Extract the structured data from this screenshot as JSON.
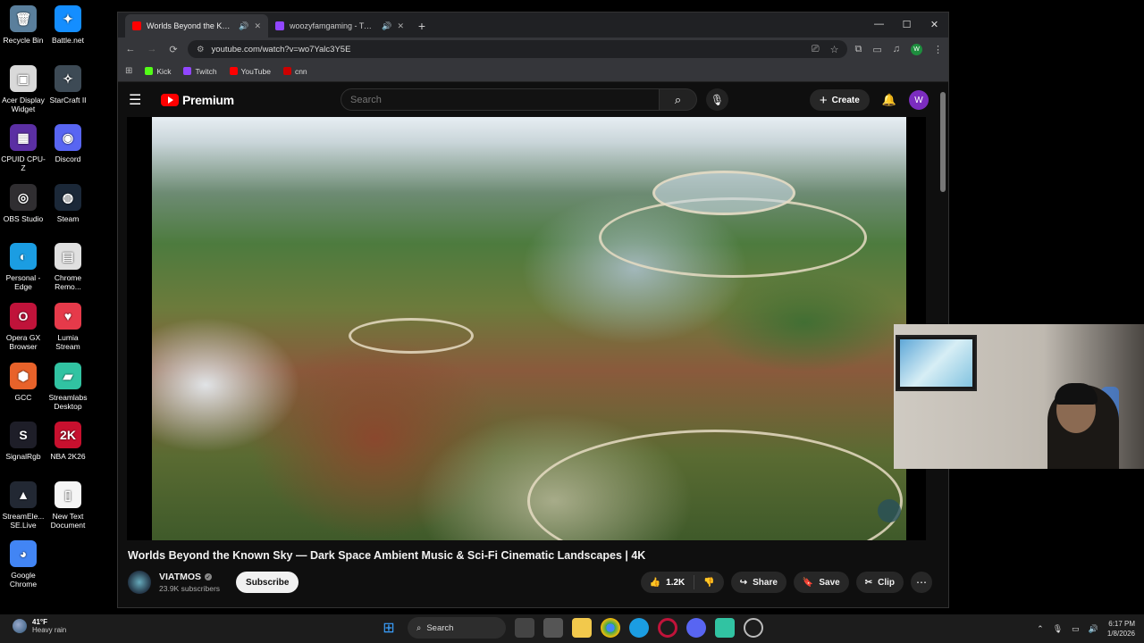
{
  "desktop": {
    "icons": [
      {
        "label": "Recycle Bin",
        "glyph": "🗑",
        "color": "#5a7f9c"
      },
      {
        "label": "Battle.net",
        "glyph": "✦",
        "color": "#148eff"
      },
      {
        "label": "Acer Display Widget",
        "glyph": "▣",
        "color": "#d9d9d9"
      },
      {
        "label": "StarCraft II",
        "glyph": "✧",
        "color": "#3d4a55"
      },
      {
        "label": "CPUID CPU-Z",
        "glyph": "▦",
        "color": "#5b2fa3"
      },
      {
        "label": "Discord",
        "glyph": "◉",
        "color": "#5865f2"
      },
      {
        "label": "OBS Studio",
        "glyph": "◎",
        "color": "#302e31"
      },
      {
        "label": "Steam",
        "glyph": "◍",
        "color": "#1b2838"
      },
      {
        "label": "Personal - Edge",
        "glyph": "◐",
        "color": "#1b9de2"
      },
      {
        "label": "Chrome Remo...",
        "glyph": "▤",
        "color": "#e0e0e0"
      },
      {
        "label": "Opera GX Browser",
        "glyph": "O",
        "color": "#c0133a"
      },
      {
        "label": "Lumia Stream",
        "glyph": "♥",
        "color": "#e63a4a"
      },
      {
        "label": "GCC",
        "glyph": "⬢",
        "color": "#e8622a"
      },
      {
        "label": "Streamlabs Desktop",
        "glyph": "▰",
        "color": "#31c3a2"
      },
      {
        "label": "SignalRgb",
        "glyph": "S",
        "color": "#1e1e28"
      },
      {
        "label": "NBA 2K26",
        "glyph": "2K",
        "color": "#c8102e"
      },
      {
        "label": "StreamEle... SE.Live",
        "glyph": "▲",
        "color": "#222833"
      },
      {
        "label": "New Text Document",
        "glyph": "▯",
        "color": "#f5f5f5"
      },
      {
        "label": "Google Chrome",
        "glyph": "◕",
        "color": "#4285f4"
      }
    ]
  },
  "browser": {
    "tabs": [
      {
        "title": "Worlds Beyond the Known",
        "fav_color": "#ff0000",
        "active": true
      },
      {
        "title": "woozyfamgaming - Twitch",
        "fav_color": "#9146ff",
        "active": false
      }
    ],
    "new_tab": "+",
    "win_controls": {
      "minimize": "—",
      "maximize": "☐",
      "close": "✕"
    },
    "nav": {
      "back": "←",
      "forward": "→",
      "reload": "⟳"
    },
    "url": "youtube.com/watch?v=wo7Yalc3Y5E",
    "profile_initial": "W",
    "bookmarks": [
      {
        "label": "Kick",
        "color": "#53fc18"
      },
      {
        "label": "Twitch",
        "color": "#9146ff"
      },
      {
        "label": "YouTube",
        "color": "#ff0000"
      },
      {
        "label": "cnn",
        "color": "#cc0000"
      }
    ]
  },
  "youtube": {
    "logo_text": "Premium",
    "search_placeholder": "Search",
    "create_label": "Create",
    "avatar_initial": "W",
    "video_title": "Worlds Beyond the Known Sky — Dark Space Ambient Music & Sci-Fi Cinematic Landscapes | 4K",
    "channel_name": "VIATMOS",
    "subscribers": "23.9K subscribers",
    "subscribe_label": "Subscribe",
    "likes": "1.2K",
    "share_label": "Share",
    "save_label": "Save",
    "clip_label": "Clip",
    "accent_color": "#ff0000"
  },
  "taskbar": {
    "temperature": "41°F",
    "weather": "Heavy rain",
    "search_label": "Search",
    "time": "6:17 PM",
    "date": "1/8/2026"
  }
}
